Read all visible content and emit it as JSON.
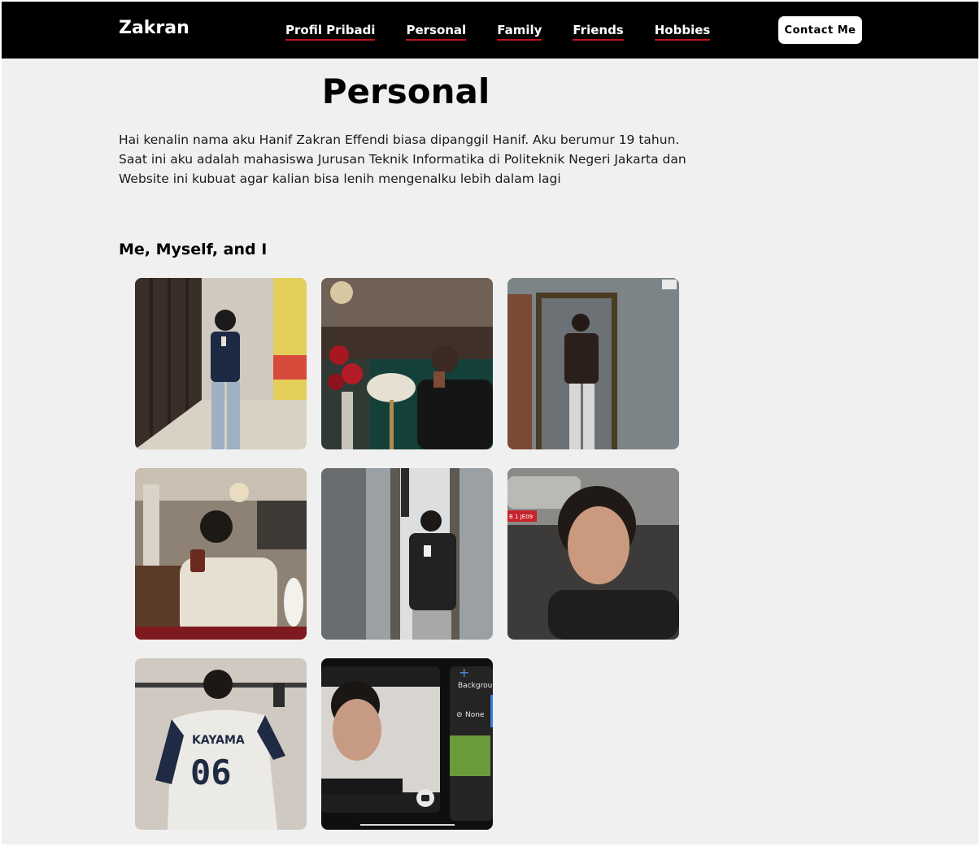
{
  "brand": "Zakran",
  "nav": [
    {
      "label": "Profil Pribadi"
    },
    {
      "label": "Personal"
    },
    {
      "label": "Family"
    },
    {
      "label": "Friends"
    },
    {
      "label": "Hobbies"
    }
  ],
  "contact_label": "Contact Me",
  "page_title": "Personal",
  "intro": "Hai kenalin nama aku Hanif Zakran Effendi biasa dipanggil Hanif. Aku berumur 19 tahun. Saat ini aku adalah mahasiswa Jurusan Teknik Informatika di Politeknik Negeri Jakarta dan Website ini kubuat agar kalian bisa lenih mengenalku lebih dalam lagi",
  "section_title": "Me, Myself, and I",
  "photo_text": {
    "jersey_name": "KAYAMA",
    "jersey_number": "06",
    "app_background": "Backgrour",
    "app_none": "None",
    "plate": "B 1 JE09"
  },
  "colors": {
    "navbar": "#000000",
    "accent_underline": "#c0121b",
    "page_background": "#f0f0f0"
  }
}
